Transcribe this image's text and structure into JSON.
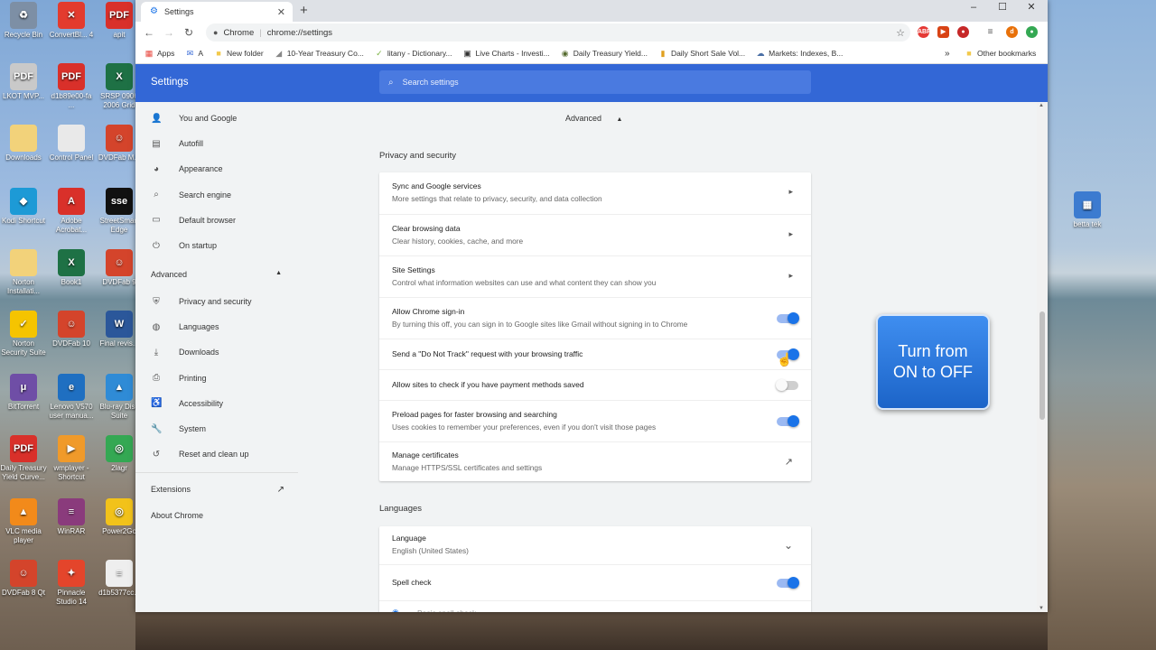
{
  "desktop": {
    "icons_left": [
      {
        "label": "Recycle Bin",
        "glyph": "♻",
        "color": "#7d8fa5"
      },
      {
        "label": "ConvertBl... 4",
        "glyph": "✕",
        "color": "#e33b2e"
      },
      {
        "label": "apit",
        "glyph": "PDF",
        "color": "#d9302a"
      },
      {
        "label": "LKOT MVP...",
        "glyph": "PDF",
        "color": "#c9c9c9"
      },
      {
        "label": "d1b89e00-fa ...",
        "glyph": "PDF",
        "color": "#d9302a"
      },
      {
        "label": "SRSP 0906 2006 Grid",
        "glyph": "X",
        "color": "#1e7145"
      },
      {
        "label": "Downloads",
        "glyph": "",
        "color": "#f2d27a"
      },
      {
        "label": "Control Panel",
        "glyph": "",
        "color": "#e9e9e9"
      },
      {
        "label": "DVDFab M...",
        "glyph": "☺",
        "color": "#d4442b"
      },
      {
        "label": "Kodi Shortcut",
        "glyph": "◆",
        "color": "#1d9ad6"
      },
      {
        "label": "Adobe Acrobat...",
        "glyph": "A",
        "color": "#d9302a"
      },
      {
        "label": "StreetSmart Edge",
        "glyph": "sse",
        "color": "#111111"
      },
      {
        "label": "Norton Installati...",
        "glyph": "",
        "color": "#f2d27a"
      },
      {
        "label": "Book1",
        "glyph": "X",
        "color": "#1e7145"
      },
      {
        "label": "DVDFab 9",
        "glyph": "☺",
        "color": "#d4442b"
      },
      {
        "label": "Norton Security Suite",
        "glyph": "✓",
        "color": "#f5c400"
      },
      {
        "label": "DVDFab 10",
        "glyph": "☺",
        "color": "#d4442b"
      },
      {
        "label": "Final revis...",
        "glyph": "W",
        "color": "#2b579a"
      },
      {
        "label": "BitTorrent",
        "glyph": "μ",
        "color": "#6f4ea6"
      },
      {
        "label": "Lenovo V570 user manua...",
        "glyph": "e",
        "color": "#1f6fc1"
      },
      {
        "label": "Blu-ray Disc Suite",
        "glyph": "▲",
        "color": "#2f8bd6"
      },
      {
        "label": "Daily Treasury Yield Curve...",
        "glyph": "PDF",
        "color": "#d9302a"
      },
      {
        "label": "wmplayer - Shortcut",
        "glyph": "▶",
        "color": "#f09a2a"
      },
      {
        "label": "2lagr",
        "glyph": "◎",
        "color": "#34a853"
      },
      {
        "label": "VLC media player",
        "glyph": "▲",
        "color": "#f28a1a"
      },
      {
        "label": "WinRAR",
        "glyph": "≡",
        "color": "#8a3b7c"
      },
      {
        "label": "Power2Go",
        "glyph": "◎",
        "color": "#f2c21a"
      },
      {
        "label": "DVDFab 8 Qt",
        "glyph": "☺",
        "color": "#d4442b"
      },
      {
        "label": "Pinnacle Studio 14",
        "glyph": "✦",
        "color": "#e4452b"
      },
      {
        "label": "d1b5377cc...",
        "glyph": "≡",
        "color": "#eeeeee"
      }
    ],
    "icon_right": {
      "label": "betta tek",
      "glyph": "▦",
      "color": "#3c7bd0"
    }
  },
  "browser": {
    "tab_title": "Settings",
    "new_tab": "+",
    "url_origin": "Chrome",
    "url_path": "chrome://settings",
    "bookmarks": [
      {
        "label": "Apps",
        "icon": "▦",
        "color": "#e8453c"
      },
      {
        "label": "A",
        "icon": "✉",
        "color": "#3367d6"
      },
      {
        "label": "New folder",
        "icon": "■",
        "color": "#f2c94c"
      },
      {
        "label": "10-Year Treasury Co...",
        "icon": "◢",
        "color": "#888888"
      },
      {
        "label": "litany - Dictionary...",
        "icon": "✓",
        "color": "#7cb342"
      },
      {
        "label": "Live Charts - Investi...",
        "icon": "▣",
        "color": "#333333"
      },
      {
        "label": "Daily Treasury Yield...",
        "icon": "◉",
        "color": "#556b2f"
      },
      {
        "label": "Daily Short Sale Vol...",
        "icon": "▮",
        "color": "#e0a020"
      },
      {
        "label": "Markets: Indexes, B...",
        "icon": "☁",
        "color": "#4a6fa5"
      }
    ],
    "bookmarks_more": "»",
    "other_bookmarks": "Other bookmarks"
  },
  "settings": {
    "title": "Settings",
    "search_placeholder": "Search settings",
    "nav": [
      {
        "label": "You and Google",
        "icon": "👤"
      },
      {
        "label": "Autofill",
        "icon": "▤"
      },
      {
        "label": "Appearance",
        "icon": "◕"
      },
      {
        "label": "Search engine",
        "icon": "⌕"
      },
      {
        "label": "Default browser",
        "icon": "▭"
      },
      {
        "label": "On startup",
        "icon": "⏻"
      }
    ],
    "advanced_label": "Advanced",
    "advanced_nav": [
      {
        "label": "Privacy and security",
        "icon": "⛨"
      },
      {
        "label": "Languages",
        "icon": "◍"
      },
      {
        "label": "Downloads",
        "icon": "⤓"
      },
      {
        "label": "Printing",
        "icon": "⎙"
      },
      {
        "label": "Accessibility",
        "icon": "♿"
      },
      {
        "label": "System",
        "icon": "🔧"
      },
      {
        "label": "Reset and clean up",
        "icon": "↺"
      }
    ],
    "extensions_label": "Extensions",
    "about_label": "About Chrome",
    "advanced_toggle": "Advanced",
    "privacy_heading": "Privacy and security",
    "privacy_rows": [
      {
        "title": "Sync and Google services",
        "subtitle": "More settings that relate to privacy, security, and data collection",
        "control": "arrow"
      },
      {
        "title": "Clear browsing data",
        "subtitle": "Clear history, cookies, cache, and more",
        "control": "arrow"
      },
      {
        "title": "Site Settings",
        "subtitle": "Control what information websites can use and what content they can show you",
        "control": "arrow"
      },
      {
        "title": "Allow Chrome sign-in",
        "subtitle": "By turning this off, you can sign in to Google sites like Gmail without signing in to Chrome",
        "control": "toggle-on"
      },
      {
        "title": "Send a \"Do Not Track\" request with your browsing traffic",
        "subtitle": "",
        "control": "toggle-on"
      },
      {
        "title": "Allow sites to check if you have payment methods saved",
        "subtitle": "",
        "control": "toggle-off"
      },
      {
        "title": "Preload pages for faster browsing and searching",
        "subtitle": "Uses cookies to remember your preferences, even if you don't visit those pages",
        "control": "toggle-on"
      },
      {
        "title": "Manage certificates",
        "subtitle": "Manage HTTPS/SSL certificates and settings",
        "control": "external"
      }
    ],
    "languages_heading": "Languages",
    "language_rows": [
      {
        "title": "Language",
        "subtitle": "English (United States)",
        "control": "expand"
      },
      {
        "title": "Spell check",
        "subtitle": "",
        "control": "toggle-on"
      },
      {
        "title": "Basic spell check",
        "subtitle": "",
        "control": "radio"
      }
    ]
  },
  "callout": {
    "line1": "Turn from",
    "line2": "ON to OFF"
  },
  "colors": {
    "header": "#3367d6",
    "toggle_on": "#1a73e8",
    "callout": "#2a78e0"
  }
}
